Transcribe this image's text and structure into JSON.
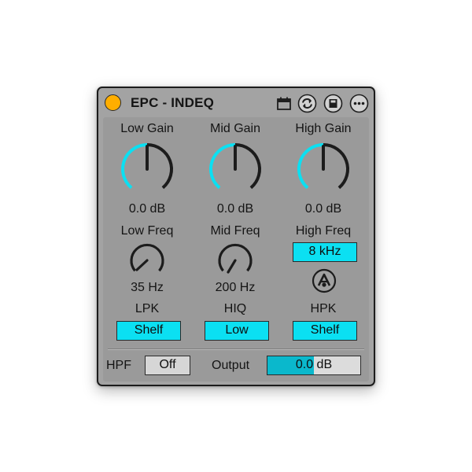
{
  "device": {
    "title": "EPC - INDEQ",
    "power_on": true,
    "accent_color": "#0be0f2",
    "power_color": "#ffae00",
    "titlebar_icons": [
      "calendar-icon",
      "refresh-icon",
      "save-icon",
      "more-icon"
    ]
  },
  "gains": [
    {
      "label": "Low Gain",
      "value_text": "0.0 dB",
      "level": 0.5
    },
    {
      "label": "Mid Gain",
      "value_text": "0.0 dB",
      "level": 0.5
    },
    {
      "label": "High Gain",
      "value_text": "0.0 dB",
      "level": 0.5
    }
  ],
  "freqs": {
    "low": {
      "label": "Low Freq",
      "value_text": "35 Hz"
    },
    "mid": {
      "label": "Mid Freq",
      "value_text": "200 Hz"
    },
    "high": {
      "label": "High Freq",
      "value_text": "8 kHz"
    }
  },
  "modes": {
    "lpk": {
      "label": "LPK",
      "value": "Shelf"
    },
    "hiq": {
      "label": "HIQ",
      "value": "Low"
    },
    "hpk": {
      "label": "HPK",
      "value": "Shelf"
    }
  },
  "hpf": {
    "label": "HPF",
    "value": "Off"
  },
  "output": {
    "label": "Output",
    "value_text": "0.0 dB",
    "level": 0.5
  }
}
